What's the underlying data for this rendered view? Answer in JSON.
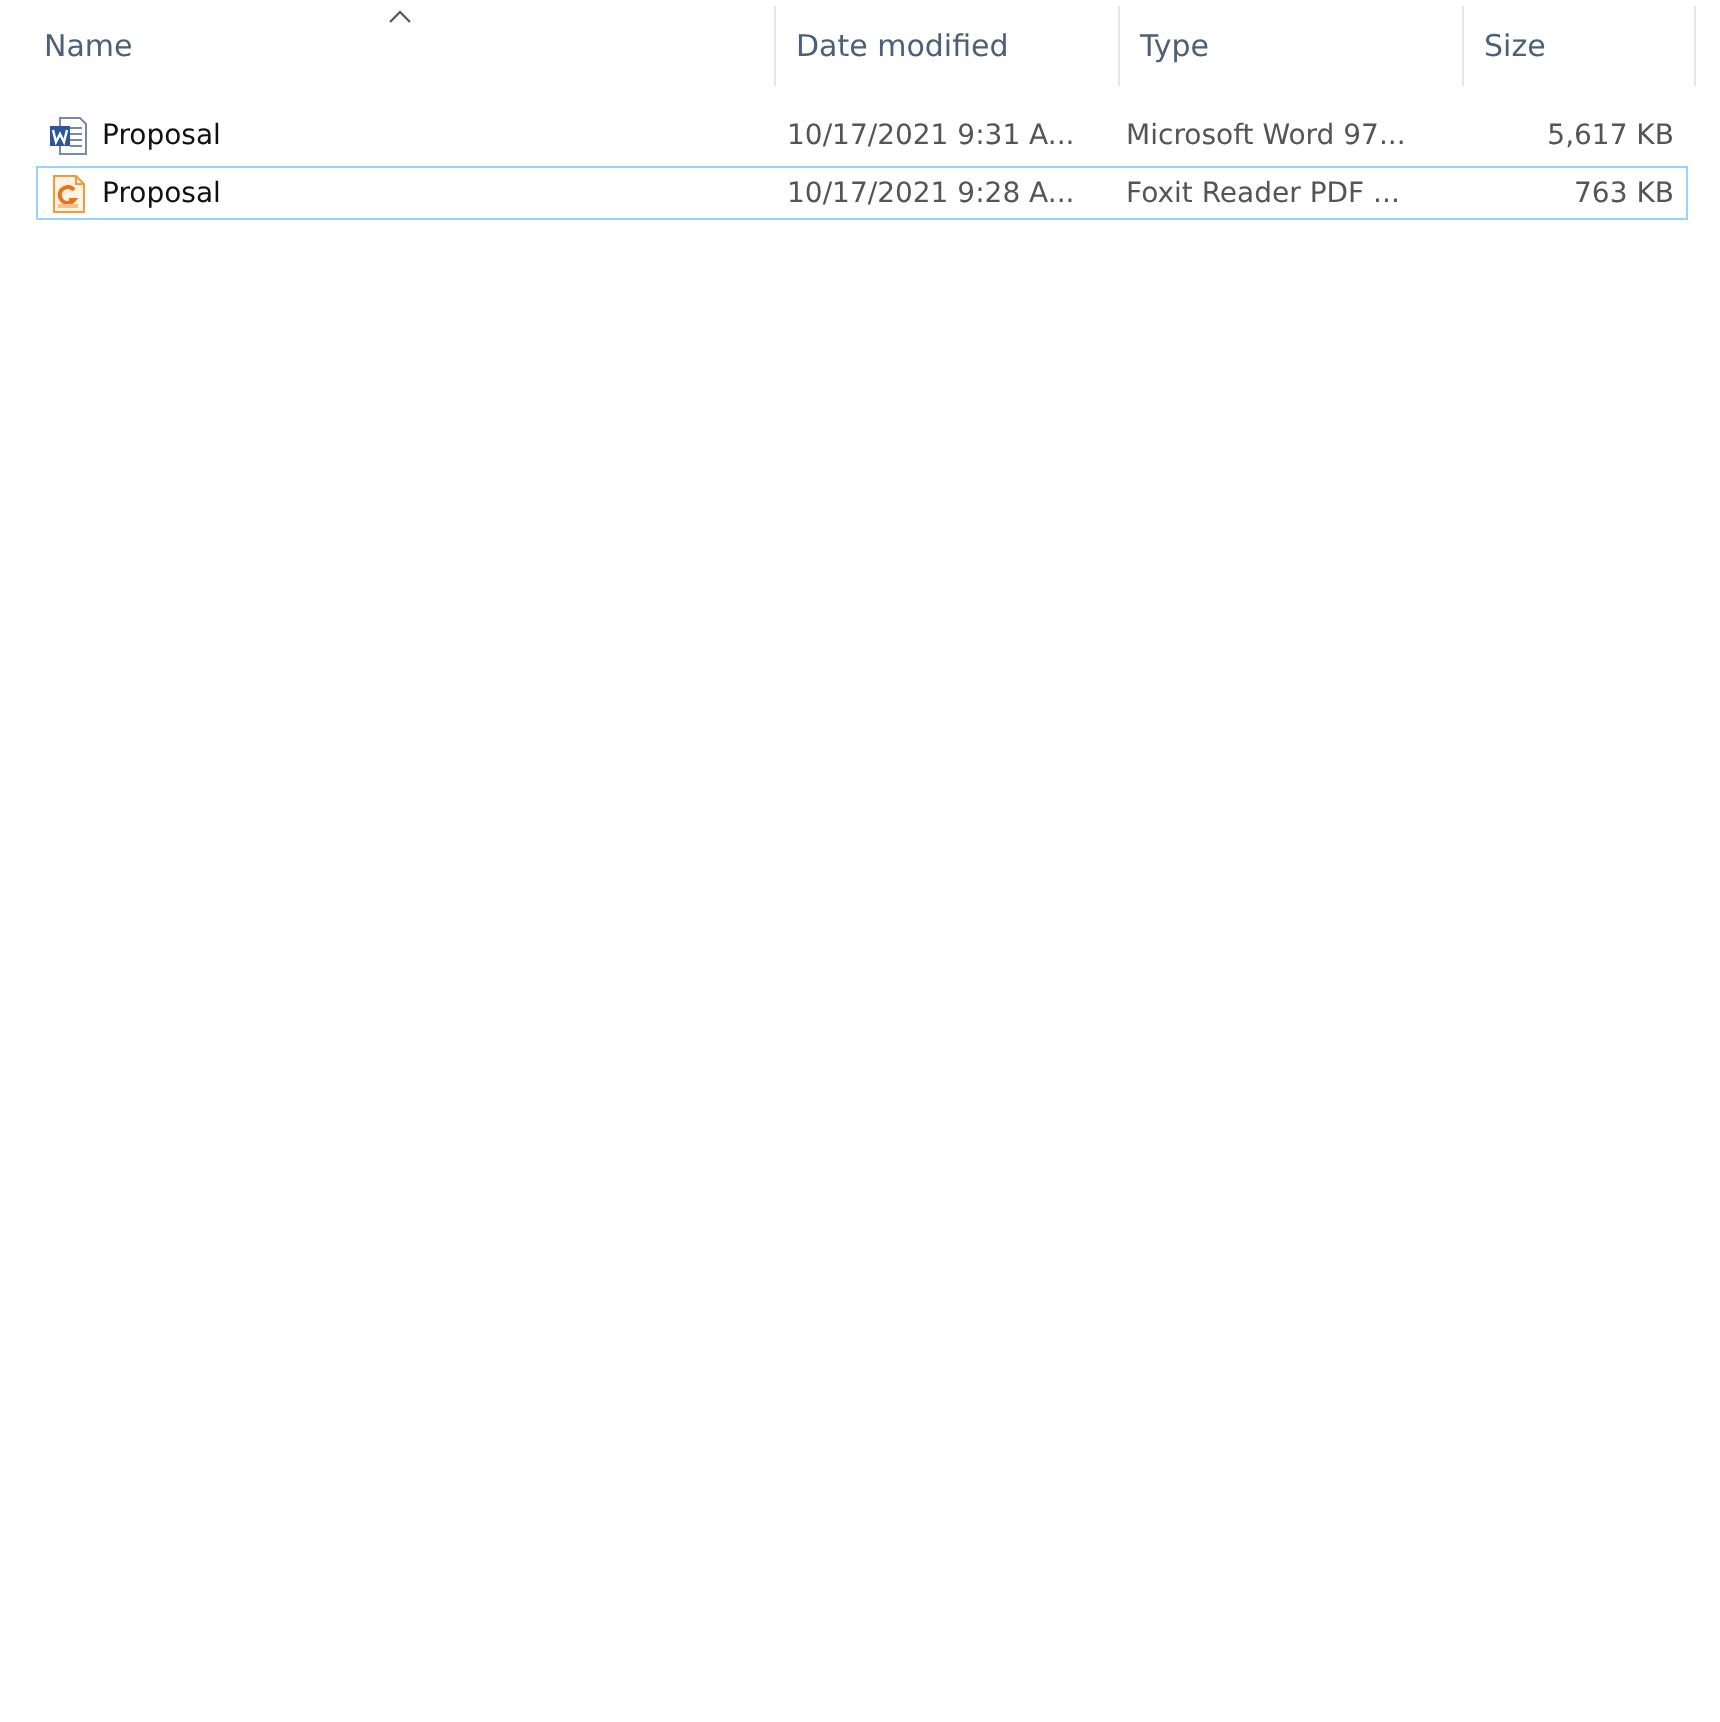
{
  "columns": [
    {
      "label": "Name",
      "sorted": true
    },
    {
      "label": "Date modified",
      "sorted": false
    },
    {
      "label": "Type",
      "sorted": false
    },
    {
      "label": "Size",
      "sorted": false
    }
  ],
  "rows": [
    {
      "kind": "word",
      "name": "Proposal",
      "date": "10/17/2021 9:31 A...",
      "type": "Microsoft Word 97...",
      "size": "5,617 KB",
      "focused": false
    },
    {
      "kind": "pdf",
      "name": "Proposal",
      "date": "10/17/2021 9:28 A...",
      "type": "Foxit Reader PDF ...",
      "size": "763 KB",
      "focused": true
    }
  ]
}
